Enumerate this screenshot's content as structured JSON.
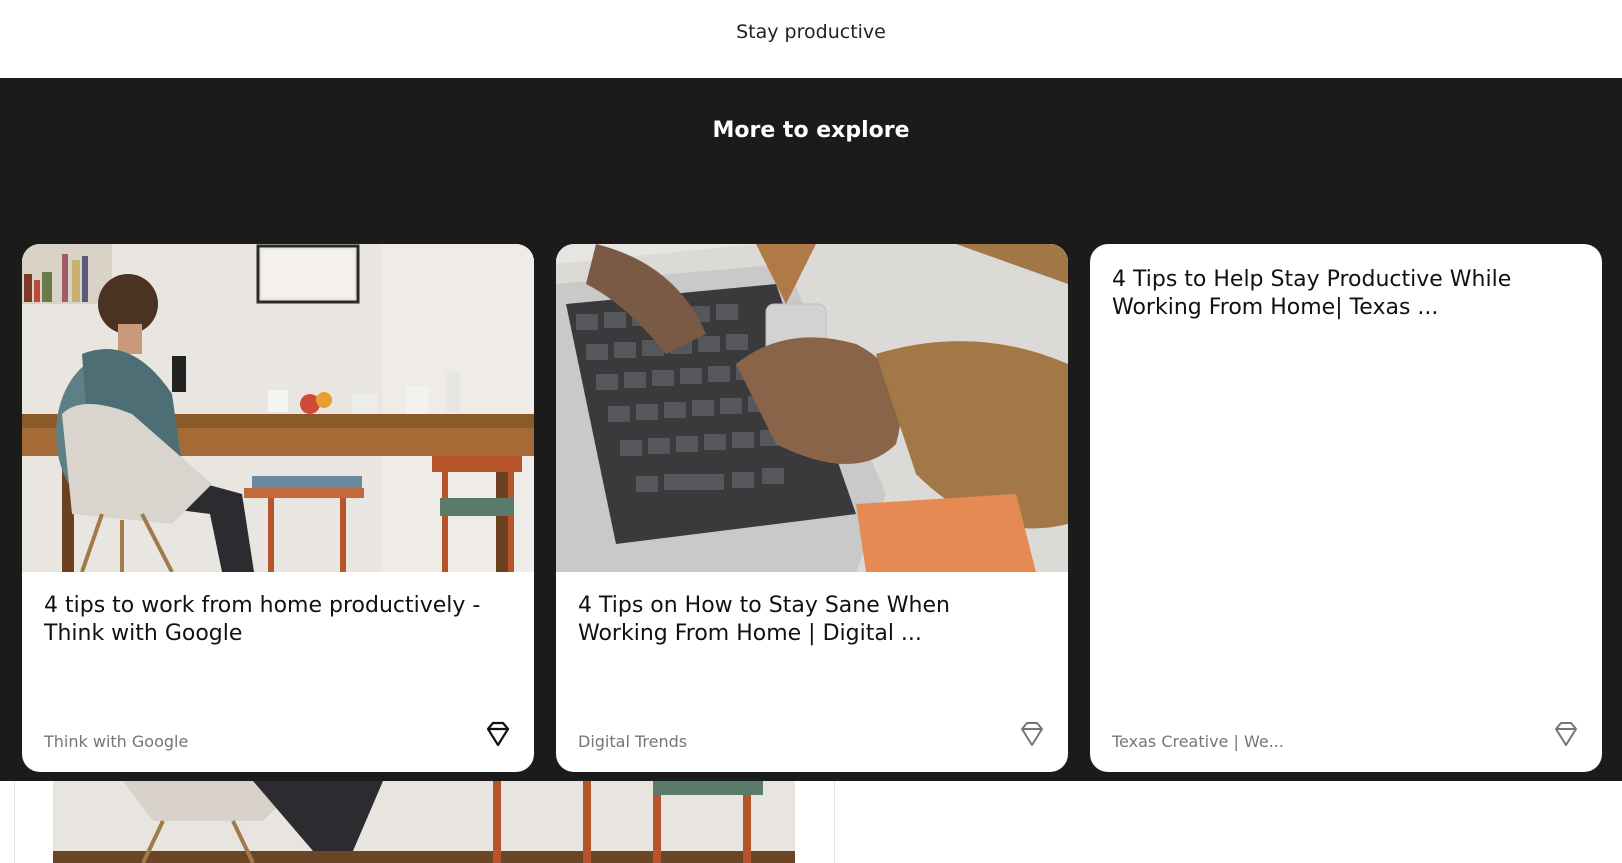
{
  "header": {
    "title": "Stay productive"
  },
  "explore": {
    "heading": "More to explore",
    "cards": [
      {
        "title": "4 tips to work from home productively - Think with Google",
        "source": "Think with Google",
        "image": "man working at dining table"
      },
      {
        "title": "4 Tips on How to Stay Sane When Working From Home | Digital ...",
        "source": "Digital Trends",
        "image": "hands typing on laptop"
      },
      {
        "title": "4 Tips to Help Stay Productive While Working From Home| Texas ...",
        "source": "Texas Creative | We..."
      }
    ]
  },
  "icons": {
    "save": "diamond-save-icon"
  },
  "colors": {
    "explore_bg": "#1b1b1b",
    "card_bg": "#ffffff",
    "source_text": "#767676"
  }
}
